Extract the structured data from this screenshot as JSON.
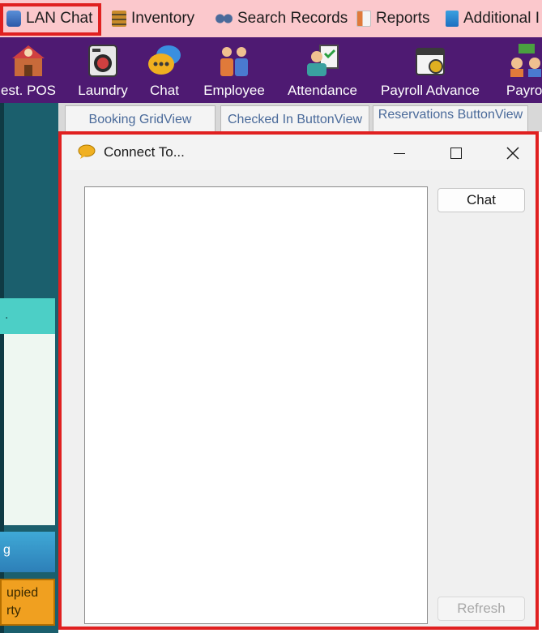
{
  "menu": {
    "items": [
      {
        "label": "LAN Chat",
        "icon": "lan-chat-icon"
      },
      {
        "label": "Inventory",
        "icon": "inventory-icon"
      },
      {
        "label": "Search Records",
        "icon": "search-records-icon"
      },
      {
        "label": "Reports",
        "icon": "reports-icon"
      },
      {
        "label": "Additional I",
        "icon": "additional-icon"
      }
    ]
  },
  "toolbar": {
    "items": [
      {
        "label": "est. POS",
        "icon": "restaurant-pos-icon"
      },
      {
        "label": "Laundry",
        "icon": "laundry-icon"
      },
      {
        "label": "Chat",
        "icon": "chat-icon"
      },
      {
        "label": "Employee",
        "icon": "employee-icon"
      },
      {
        "label": "Attendance",
        "icon": "attendance-icon"
      },
      {
        "label": "Payroll Advance",
        "icon": "payroll-advance-icon"
      },
      {
        "label": "Payrol",
        "icon": "payroll-icon"
      }
    ]
  },
  "tabs": [
    {
      "label": "Booking GridView"
    },
    {
      "label": "Checked In ButtonView"
    },
    {
      "label": "Reservations ButtonView"
    }
  ],
  "left_panel": {
    "bar_text": ".",
    "blue_text": "g",
    "orange_line1": "upied",
    "orange_line2": "rty"
  },
  "dialog": {
    "title": "Connect To...",
    "chat_button": "Chat",
    "refresh_button": "Refresh",
    "refresh_enabled": false
  },
  "colors": {
    "menubar": "#fbc8cc",
    "toolbar": "#4e1a72",
    "highlight": "#e02020",
    "panel_teal": "#1b5f6d"
  }
}
